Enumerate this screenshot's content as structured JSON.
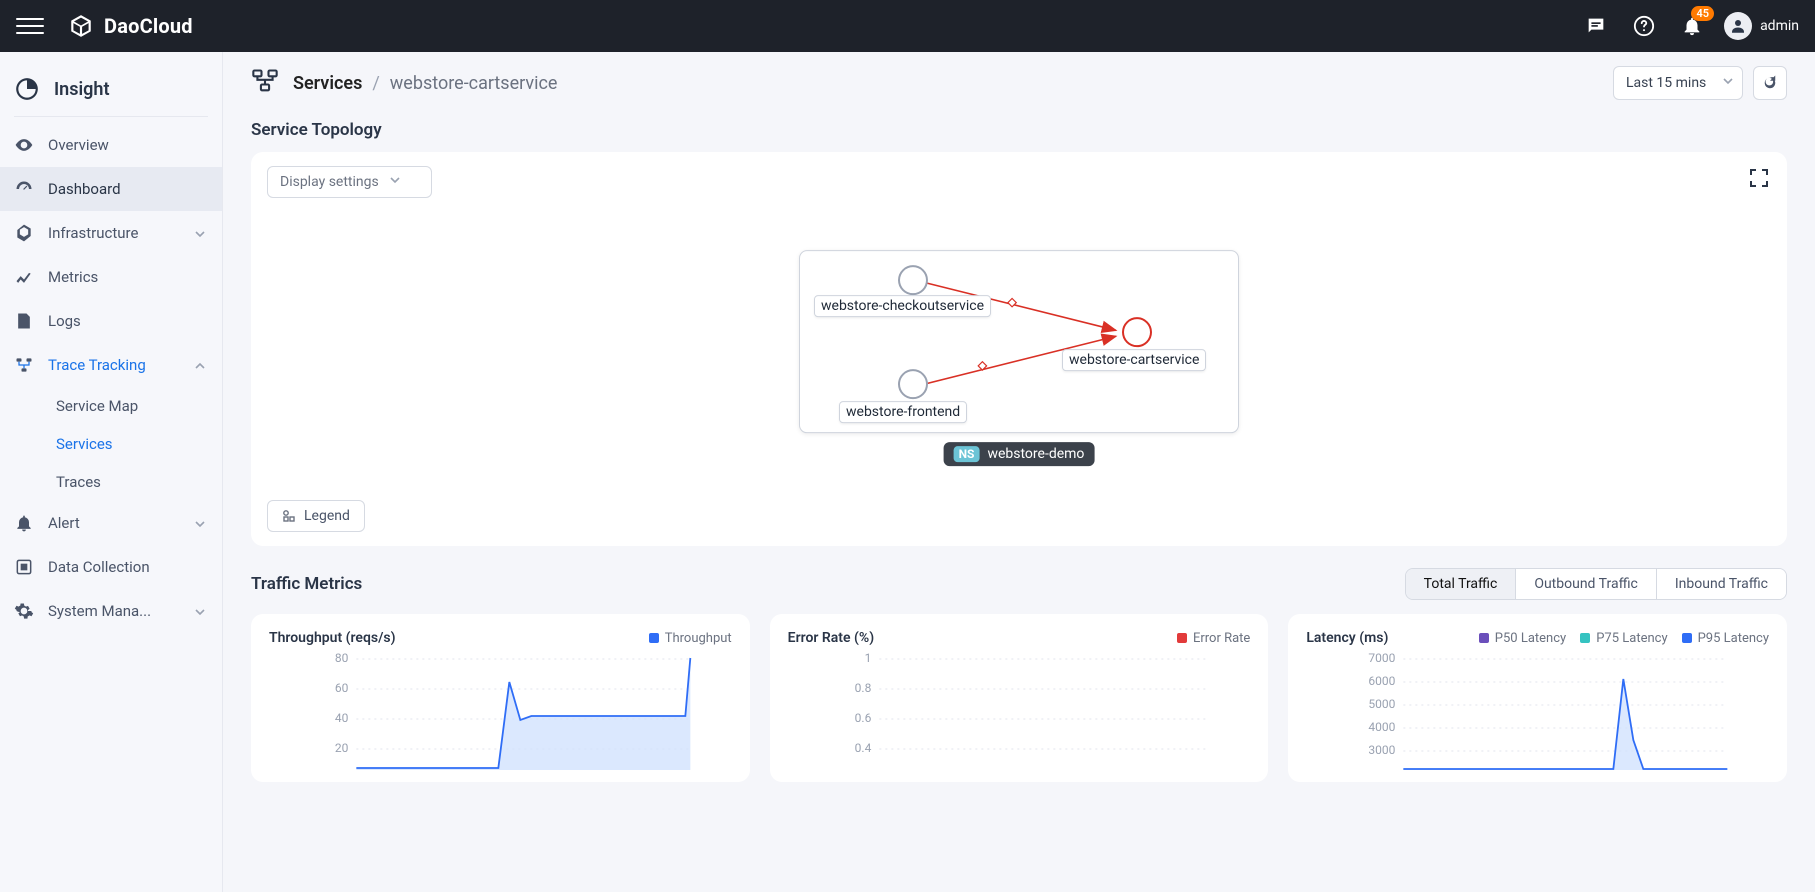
{
  "topbar": {
    "brand": "DaoCloud",
    "notification_badge": "45",
    "user": "admin"
  },
  "sidebar": {
    "section": "Insight",
    "items": [
      {
        "label": "Overview",
        "icon": "eye"
      },
      {
        "label": "Dashboard",
        "icon": "dashboard",
        "active": true
      },
      {
        "label": "Infrastructure",
        "icon": "hex",
        "expandable": true
      },
      {
        "label": "Metrics",
        "icon": "metrics"
      },
      {
        "label": "Logs",
        "icon": "logs"
      },
      {
        "label": "Trace Tracking",
        "icon": "trace",
        "expanded": true,
        "highlight": true,
        "children": [
          {
            "label": "Service Map"
          },
          {
            "label": "Services",
            "active": true
          },
          {
            "label": "Traces"
          }
        ]
      },
      {
        "label": "Alert",
        "icon": "bell",
        "expandable": true
      },
      {
        "label": "Data Collection",
        "icon": "collect"
      },
      {
        "label": "System Mana...",
        "icon": "gear",
        "expandable": true
      }
    ]
  },
  "header": {
    "breadcrumb_root": "Services",
    "breadcrumb_current": "webstore-cartservice",
    "time_range": "Last 15 mins"
  },
  "topology": {
    "section_title": "Service Topology",
    "display_settings_label": "Display settings",
    "legend_label": "Legend",
    "namespace_badge": "NS",
    "namespace": "webstore-demo",
    "nodes": {
      "checkout": "webstore-checkoutservice",
      "frontend": "webstore-frontend",
      "cart": "webstore-cartservice"
    }
  },
  "traffic": {
    "section_title": "Traffic Metrics",
    "tabs": [
      "Total Traffic",
      "Outbound Traffic",
      "Inbound Traffic"
    ],
    "active_tab": "Total Traffic"
  },
  "chart_data": [
    {
      "type": "line",
      "title": "Throughput (reqs/s)",
      "ylabel": "reqs/s",
      "ylim": [
        0,
        80
      ],
      "yticks": [
        80,
        60,
        40,
        20
      ],
      "series": [
        {
          "name": "Throughput",
          "color": "#2f6df6",
          "values": [
            2,
            2,
            2,
            2,
            2,
            2,
            2,
            2,
            2,
            2,
            2,
            2,
            2,
            68,
            35,
            38,
            36,
            36,
            36,
            36,
            36,
            36,
            36,
            36,
            36,
            36,
            36,
            36,
            36,
            36,
            85
          ]
        }
      ]
    },
    {
      "type": "line",
      "title": "Error Rate (%)",
      "ylabel": "%",
      "ylim": [
        0,
        1
      ],
      "yticks": [
        1,
        0.8,
        0.6,
        0.4
      ],
      "series": [
        {
          "name": "Error Rate",
          "color": "#e23b3b",
          "values": []
        }
      ]
    },
    {
      "type": "line",
      "title": "Latency (ms)",
      "ylabel": "ms",
      "ylim": [
        0,
        7000
      ],
      "yticks": [
        7000,
        6000,
        5000,
        4000,
        3000
      ],
      "series": [
        {
          "name": "P50 Latency",
          "color": "#6b4fbb",
          "values": [
            50,
            50,
            50,
            50,
            50,
            50,
            50,
            50,
            50,
            50,
            50,
            50,
            50,
            50,
            50,
            50,
            50,
            50,
            50,
            50,
            50,
            50,
            50,
            50,
            50,
            50,
            50,
            6100,
            1800,
            50,
            50
          ]
        },
        {
          "name": "P75 Latency",
          "color": "#35c3c1",
          "values": [
            50,
            50,
            50,
            50,
            50,
            50,
            50,
            50,
            50,
            50,
            50,
            50,
            50,
            50,
            50,
            50,
            50,
            50,
            50,
            50,
            50,
            50,
            50,
            50,
            50,
            50,
            50,
            6100,
            1800,
            50,
            50
          ]
        },
        {
          "name": "P95 Latency",
          "color": "#2f6df6",
          "values": [
            50,
            50,
            50,
            50,
            50,
            50,
            50,
            50,
            50,
            50,
            50,
            50,
            50,
            50,
            50,
            50,
            50,
            50,
            50,
            50,
            50,
            50,
            50,
            50,
            50,
            50,
            50,
            6100,
            1800,
            50,
            50
          ]
        }
      ]
    }
  ]
}
